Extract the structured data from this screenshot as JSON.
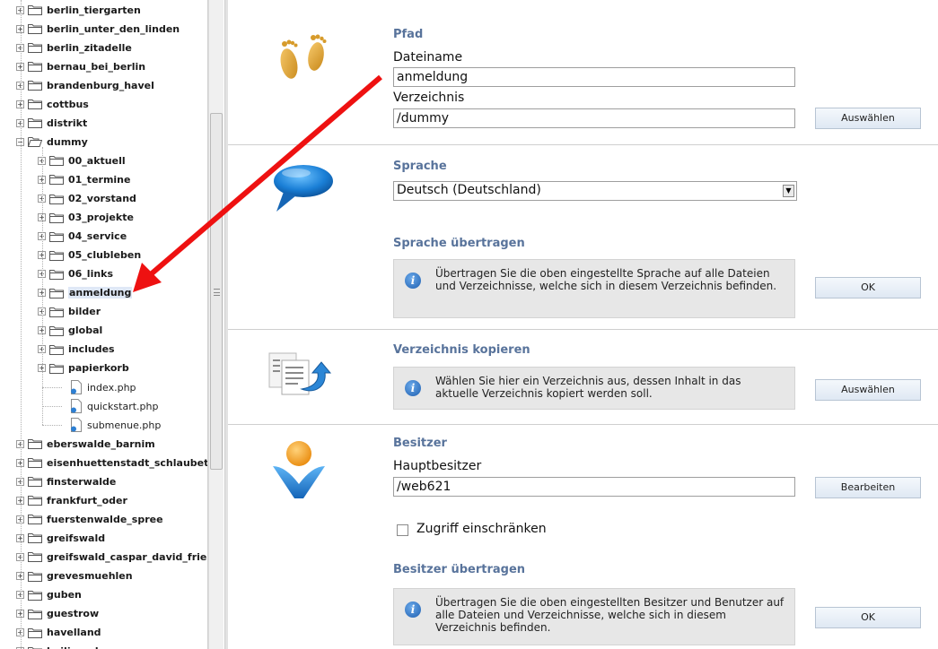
{
  "tree": {
    "items": [
      {
        "label": "berlin_tiergarten",
        "type": "folder",
        "level": 0,
        "expanded": false
      },
      {
        "label": "berlin_unter_den_linden",
        "type": "folder",
        "level": 0,
        "expanded": false
      },
      {
        "label": "berlin_zitadelle",
        "type": "folder",
        "level": 0,
        "expanded": false
      },
      {
        "label": "bernau_bei_berlin",
        "type": "folder",
        "level": 0,
        "expanded": false
      },
      {
        "label": "brandenburg_havel",
        "type": "folder",
        "level": 0,
        "expanded": false
      },
      {
        "label": "cottbus",
        "type": "folder",
        "level": 0,
        "expanded": false
      },
      {
        "label": "distrikt",
        "type": "folder",
        "level": 0,
        "expanded": false
      },
      {
        "label": "dummy",
        "type": "folder",
        "level": 0,
        "expanded": true
      },
      {
        "label": "00_aktuell",
        "type": "folder",
        "level": 1,
        "expanded": false
      },
      {
        "label": "01_termine",
        "type": "folder",
        "level": 1,
        "expanded": false
      },
      {
        "label": "02_vorstand",
        "type": "folder",
        "level": 1,
        "expanded": false
      },
      {
        "label": "03_projekte",
        "type": "folder",
        "level": 1,
        "expanded": false
      },
      {
        "label": "04_service",
        "type": "folder",
        "level": 1,
        "expanded": false
      },
      {
        "label": "05_clubleben",
        "type": "folder",
        "level": 1,
        "expanded": false
      },
      {
        "label": "06_links",
        "type": "folder",
        "level": 1,
        "expanded": false
      },
      {
        "label": "anmeldung",
        "type": "folder",
        "level": 1,
        "expanded": false,
        "selected": true
      },
      {
        "label": "bilder",
        "type": "folder",
        "level": 1,
        "expanded": false
      },
      {
        "label": "global",
        "type": "folder",
        "level": 1,
        "expanded": false
      },
      {
        "label": "includes",
        "type": "folder",
        "level": 1,
        "expanded": false
      },
      {
        "label": "papierkorb",
        "type": "folder",
        "level": 1,
        "expanded": false
      },
      {
        "label": "index.php",
        "type": "file",
        "level": 1
      },
      {
        "label": "quickstart.php",
        "type": "file",
        "level": 1
      },
      {
        "label": "submenue.php",
        "type": "file",
        "level": 1
      },
      {
        "label": "eberswalde_barnim",
        "type": "folder",
        "level": 0,
        "expanded": false
      },
      {
        "label": "eisenhuettenstadt_schlaubeta",
        "type": "folder",
        "level": 0,
        "expanded": false
      },
      {
        "label": "finsterwalde",
        "type": "folder",
        "level": 0,
        "expanded": false
      },
      {
        "label": "frankfurt_oder",
        "type": "folder",
        "level": 0,
        "expanded": false
      },
      {
        "label": "fuerstenwalde_spree",
        "type": "folder",
        "level": 0,
        "expanded": false
      },
      {
        "label": "greifswald",
        "type": "folder",
        "level": 0,
        "expanded": false
      },
      {
        "label": "greifswald_caspar_david_frie",
        "type": "folder",
        "level": 0,
        "expanded": false
      },
      {
        "label": "grevesmuehlen",
        "type": "folder",
        "level": 0,
        "expanded": false
      },
      {
        "label": "guben",
        "type": "folder",
        "level": 0,
        "expanded": false
      },
      {
        "label": "guestrow",
        "type": "folder",
        "level": 0,
        "expanded": false
      },
      {
        "label": "havelland",
        "type": "folder",
        "level": 0,
        "expanded": false
      },
      {
        "label": "heiligendamm",
        "type": "folder",
        "level": 0,
        "expanded": false
      }
    ]
  },
  "path": {
    "title": "Pfad",
    "filename_label": "Dateiname",
    "filename_value": "anmeldung",
    "directory_label": "Verzeichnis",
    "directory_value": "/dummy",
    "choose_button": "Auswählen"
  },
  "language": {
    "title": "Sprache",
    "selected": "Deutsch (Deutschland)",
    "transfer_title": "Sprache übertragen",
    "transfer_info": "Übertragen Sie die oben eingestellte Sprache auf alle Dateien und Verzeichnisse, welche sich in diesem Verzeichnis befinden.",
    "ok_button": "OK"
  },
  "copy_dir": {
    "title": "Verzeichnis kopieren",
    "info": "Wählen Sie hier ein Verzeichnis aus, dessen Inhalt in das aktuelle Verzeichnis kopiert werden soll.",
    "choose_button": "Auswählen"
  },
  "owner": {
    "title": "Besitzer",
    "main_owner_label": "Hauptbesitzer",
    "main_owner_value": "/web621",
    "edit_button": "Bearbeiten",
    "restrict_label": "Zugriff einschränken",
    "restrict_checked": false,
    "transfer_title": "Besitzer übertragen",
    "transfer_info": "Übertragen Sie die oben eingestellten Besitzer und Benutzer auf alle Dateien und Verzeichnisse, welche sich in diesem Verzeichnis befinden.",
    "ok_button": "OK"
  },
  "colors": {
    "section_title": "#58739b",
    "annotation_arrow": "#ee1111",
    "selection_bg": "#dfe8f6"
  },
  "icons": {
    "path": "footprints-icon",
    "language": "speech-bubble-icon",
    "copy": "copy-document-icon",
    "owner": "user-icon"
  }
}
